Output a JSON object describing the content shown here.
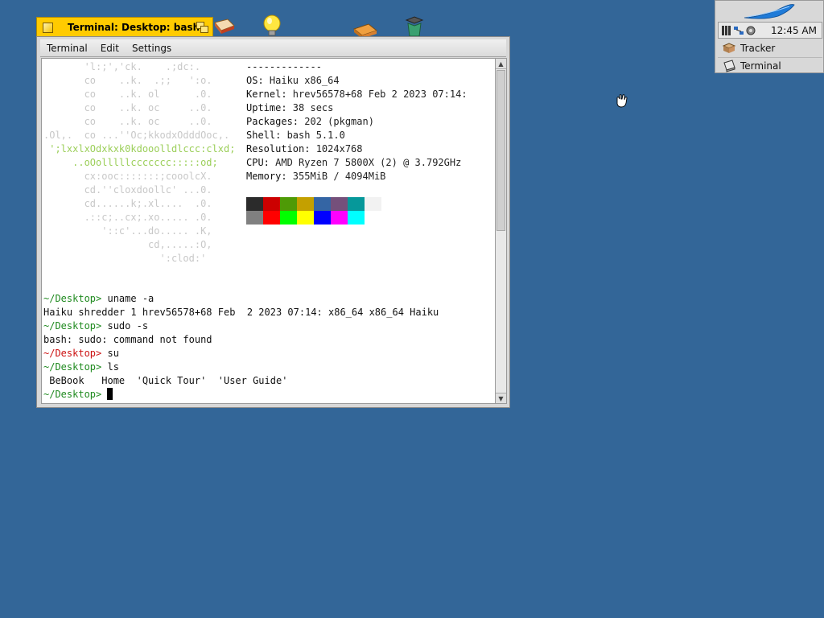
{
  "window": {
    "title": "Terminal: Desktop: bash",
    "menu": [
      "Terminal",
      "Edit",
      "Settings"
    ]
  },
  "neofetch": {
    "separator": "-------------",
    "info": [
      {
        "key": "OS:",
        "value": " Haiku x86_64"
      },
      {
        "key": "Kernel:",
        "value": " hrev56578+68 Feb 2 2023 07:14:"
      },
      {
        "key": "Uptime:",
        "value": " 38 secs"
      },
      {
        "key": "Packages:",
        "value": " 202 (pkgman)"
      },
      {
        "key": "Shell:",
        "value": " bash 5.1.0"
      },
      {
        "key": "Resolution:",
        "value": " 1024x768"
      },
      {
        "key": "CPU:",
        "value": " AMD Ryzen 7 5800X (2) @ 3.792GHz"
      },
      {
        "key": "Memory:",
        "value": " 355MiB / 4094MiB"
      }
    ],
    "art": [
      "       'l:;','ck.    .;dc:.",
      "       co    ..k.  .;;   ':o.",
      "       co    ..k. ol      .0.",
      "       co    ..k. oc     ..0.",
      "       co    ..k. oc     ..0.",
      ".Ol,.  co ...''Oc;kkodxOdddOoc,.",
      " ';lxxlxOdxkxk0kdooolldlccc:clxd;",
      "     ..oOolllllccccccc:::::od;",
      "       cx:ooc:::::::;cooolcX.",
      "       cd.''cloxdoollc' ...0.",
      "       cd......k;.xl....  .0.",
      "       .::c;..cx;.xo..... .0.",
      "          '::c'...do..... .K,",
      "                  cd,.....:O,",
      "                    ':clod:'"
    ],
    "colors_dark": [
      "#2b2b2b",
      "#cc0000",
      "#4e9a06",
      "#c4a000",
      "#3465a4",
      "#75507b",
      "#06989a",
      "#f2f2f2"
    ],
    "colors_bright": [
      "#808080",
      "#ff0000",
      "#00ff00",
      "#ffff00",
      "#0000ff",
      "#ff00ff",
      "#00ffff",
      "#ffffff"
    ]
  },
  "history": [
    {
      "prompt": "~/Desktop>",
      "cmd": " uname -a",
      "red": false
    },
    {
      "out": "Haiku shredder 1 hrev56578+68 Feb  2 2023 07:14: x86_64 x86_64 Haiku"
    },
    {
      "prompt": "~/Desktop>",
      "cmd": " sudo -s",
      "red": false
    },
    {
      "out": "bash: sudo: command not found"
    },
    {
      "prompt": "~/Desktop>",
      "cmd": " su",
      "red": true
    },
    {
      "prompt": "~/Desktop>",
      "cmd": " ls",
      "red": false
    },
    {
      "out": " BeBook   Home  'Quick Tour'  'User Guide'"
    },
    {
      "prompt": "~/Desktop>",
      "cmd": " ",
      "red": false,
      "cursor": true
    }
  ],
  "deskbar": {
    "clock": "12:45 AM",
    "items": [
      "Tracker",
      "Terminal"
    ]
  }
}
